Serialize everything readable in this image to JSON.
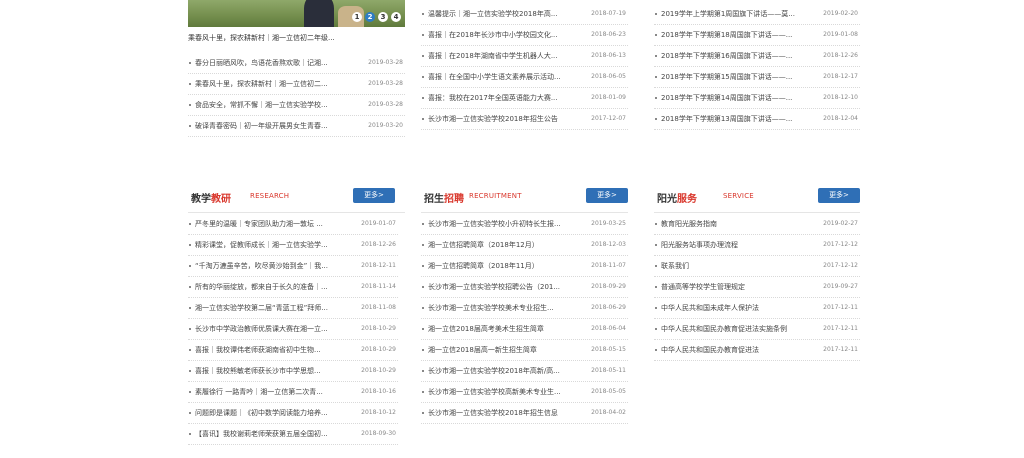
{
  "slider": {
    "caption": "乘春风十里，探农耕新村｜湘一立信初二年级...",
    "dots": [
      "1",
      "2",
      "3",
      "4"
    ],
    "active_dot": 1
  },
  "left_news": [
    {
      "title": "春分日丽晒风吹，鸟语花香熬欢歌｜记湘...",
      "date": "2019-03-28"
    },
    {
      "title": "乘春风十里，探农耕新村｜湘一立信初二...",
      "date": "2019-03-28"
    },
    {
      "title": "食品安全，常抓不懈｜湘一立信实验学校...",
      "date": "2019-03-28"
    },
    {
      "title": "破译青春密码｜初一年级开展男女生青春...",
      "date": "2019-03-20"
    }
  ],
  "mid_news": [
    {
      "title": "温馨提示｜湘一立信实验学校2018年高...",
      "date": "2018-07-19"
    },
    {
      "title": "喜报｜在2018年长沙市中小学校园文化...",
      "date": "2018-06-23"
    },
    {
      "title": "喜报｜在2018年湖南省中学生机器人大...",
      "date": "2018-06-13"
    },
    {
      "title": "喜报｜在全国中小学生语文素养展示活动...",
      "date": "2018-06-05"
    },
    {
      "title": "喜报：我校在2017年全国英语能力大赛...",
      "date": "2018-01-09"
    },
    {
      "title": "长沙市湘一立信实验学校2018年招生公告",
      "date": "2017-12-07"
    }
  ],
  "right_news": [
    {
      "title": "2019学年上学期第1周国旗下讲话——莫...",
      "date": "2019-02-20"
    },
    {
      "title": "2018学年下学期第18周国旗下讲话——...",
      "date": "2019-01-08"
    },
    {
      "title": "2018学年下学期第16周国旗下讲话——...",
      "date": "2018-12-26"
    },
    {
      "title": "2018学年下学期第15周国旗下讲话——...",
      "date": "2018-12-17"
    },
    {
      "title": "2018学年下学期第14周国旗下讲话——...",
      "date": "2018-12-10"
    },
    {
      "title": "2018学年下学期第13周国旗下讲话——...",
      "date": "2018-12-04"
    }
  ],
  "sections": {
    "research": {
      "title_a": "教学",
      "title_b": "教研",
      "english": "RESEARCH",
      "more": "更多>",
      "items": [
        {
          "title": "严冬里的温暖｜专家团队助力湘一敦坛 ...",
          "date": "2019-01-07"
        },
        {
          "title": "精彩课堂，促教师成长｜湘一立信实验学...",
          "date": "2018-12-26"
        },
        {
          "title": "“千淘万漉虽辛苦，吹尽黄沙始到金”｜我...",
          "date": "2018-12-11"
        },
        {
          "title": "所有的华丽绽放，都来自于长久的准备｜...",
          "date": "2018-11-14"
        },
        {
          "title": "湘一立信实验学校第二届“青蓝工程”拜师...",
          "date": "2018-11-08"
        },
        {
          "title": "长沙市中学政治教师优质课大赛在湘一立...",
          "date": "2018-10-29"
        },
        {
          "title": "喜报｜我校谭伟老师获湖南省初中生物...",
          "date": "2018-10-29"
        },
        {
          "title": "喜报｜我校熊敏老师获长沙市中学思想...",
          "date": "2018-10-29"
        },
        {
          "title": "素履徐行 一路青吟｜湘一立信第二次青...",
          "date": "2018-10-16"
        },
        {
          "title": "问题即是课题｜《初中数学阅读能力培养...",
          "date": "2018-10-12"
        },
        {
          "title": "【喜讯】我校谢莉老师荣获第五届全国初...",
          "date": "2018-09-30"
        }
      ]
    },
    "recruitment": {
      "title_a": "招生",
      "title_b": "招聘",
      "english": "RECRUITMENT",
      "more": "更多>",
      "items": [
        {
          "title": "长沙市湘一立信实验学校小升初特长生报...",
          "date": "2019-03-25"
        },
        {
          "title": "湘一立信招聘简章（2018年12月）",
          "date": "2018-12-03"
        },
        {
          "title": "湘一立信招聘简章（2018年11月）",
          "date": "2018-11-07"
        },
        {
          "title": "长沙市湘一立信实验学校招聘公告（201...",
          "date": "2018-09-29"
        },
        {
          "title": "长沙市湘一立信实验学校美术专业招生...",
          "date": "2018-06-29"
        },
        {
          "title": "湘一立信2018届高考美术生招生简章",
          "date": "2018-06-04"
        },
        {
          "title": "湘一立信2018届高一新生招生简章",
          "date": "2018-05-15"
        },
        {
          "title": "长沙市湘一立信实验学校2018年高新/高...",
          "date": "2018-05-11"
        },
        {
          "title": "长沙市湘一立信实验学校高新美术专业生...",
          "date": "2018-05-05"
        },
        {
          "title": "长沙市湘一立信实验学校2018年招生信息",
          "date": "2018-04-02"
        }
      ]
    },
    "service": {
      "title_a": "阳光",
      "title_b": "服务",
      "english": "SERVICE",
      "more": "更多>",
      "items": [
        {
          "title": "教育阳光服务指南",
          "date": "2019-02-27"
        },
        {
          "title": "阳光服务站事项办理流程",
          "date": "2017-12-12"
        },
        {
          "title": "联系我们",
          "date": "2017-12-12"
        },
        {
          "title": "普通高等学校学生管理规定",
          "date": "2019-09-27"
        },
        {
          "title": "中华人民共和国未成年人保护法",
          "date": "2017-12-11"
        },
        {
          "title": "中华人民共和国民办教育促进法实施条例",
          "date": "2017-12-11"
        },
        {
          "title": "中华人民共和国民办教育促进法",
          "date": "2017-12-11"
        }
      ]
    }
  },
  "colors": {
    "accent": "#d9372c",
    "button": "#2f6fb6"
  }
}
